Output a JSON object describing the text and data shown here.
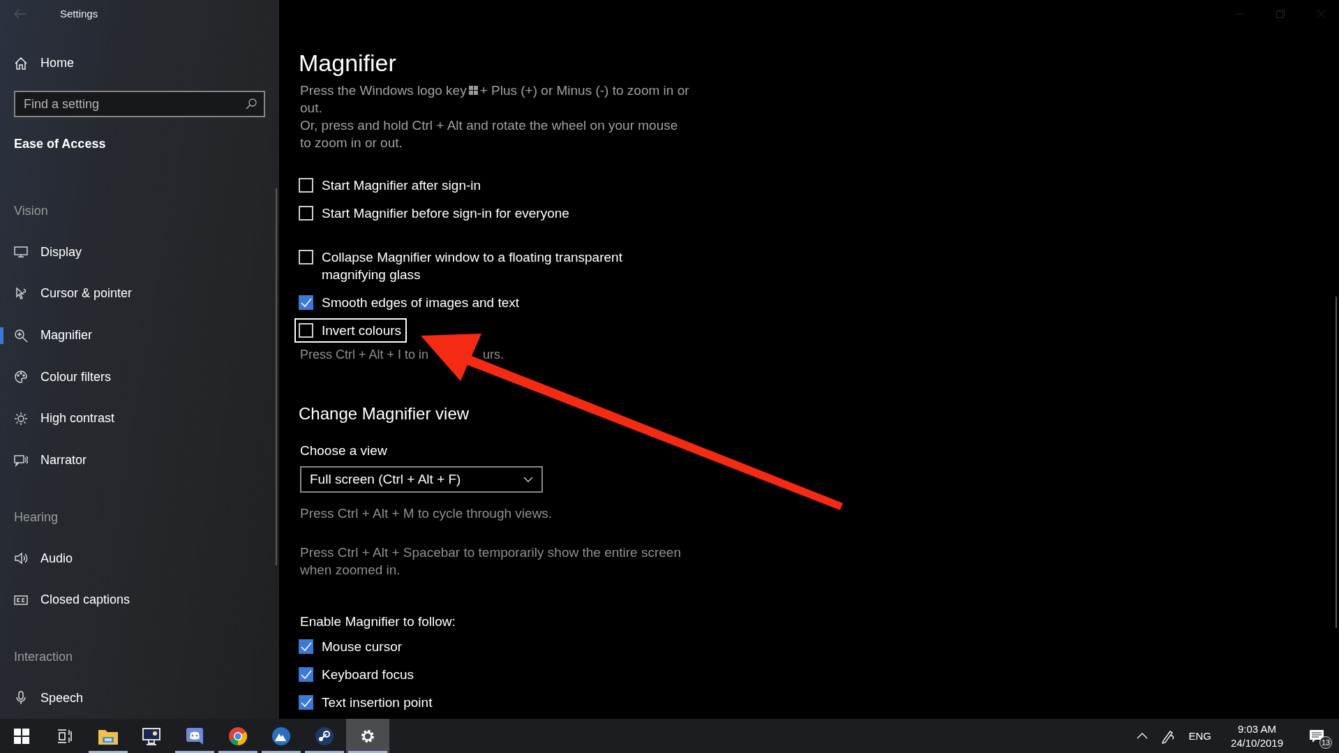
{
  "window": {
    "title": "Settings"
  },
  "sidebar": {
    "home": "Home",
    "search": {
      "placeholder": "Find a setting"
    },
    "heading": "Ease of Access",
    "groups": [
      {
        "label": "Vision",
        "items": [
          {
            "label": "Display",
            "kind": "display",
            "selected": false
          },
          {
            "label": "Cursor & pointer",
            "kind": "cursor",
            "selected": false
          },
          {
            "label": "Magnifier",
            "kind": "magnifier",
            "selected": true
          },
          {
            "label": "Colour filters",
            "kind": "palette",
            "selected": false
          },
          {
            "label": "High contrast",
            "kind": "sun",
            "selected": false
          },
          {
            "label": "Narrator",
            "kind": "narrator",
            "selected": false
          }
        ]
      },
      {
        "label": "Hearing",
        "items": [
          {
            "label": "Audio",
            "kind": "speaker",
            "selected": false
          },
          {
            "label": "Closed captions",
            "kind": "captions",
            "selected": false
          }
        ]
      },
      {
        "label": "Interaction",
        "items": [
          {
            "label": "Speech",
            "kind": "mic",
            "selected": false
          }
        ]
      }
    ]
  },
  "page": {
    "title": "Magnifier",
    "intro": {
      "before_key": "Press the Windows logo key",
      "after_key": "+ Plus (+) or Minus (-) to zoom in or",
      "continued": "out."
    },
    "intro_2": "Or, press and hold Ctrl + Alt and rotate the wheel on your mouse to zoom in or out.",
    "option_groups": [
      [
        {
          "label": "Start Magnifier after sign-in",
          "checked": false,
          "focused": false
        },
        {
          "label": "Start Magnifier before sign-in for everyone",
          "checked": false,
          "focused": false
        }
      ],
      [
        {
          "label": "Collapse Magnifier window to a floating transparent magnifying glass",
          "checked": false,
          "focused": false
        },
        {
          "label": "Smooth edges of images and text",
          "checked": true,
          "focused": false
        },
        {
          "label": "Invert colours",
          "checked": false,
          "focused": true
        }
      ]
    ],
    "invert_hint": {
      "start": "Press Ctrl + Alt + I to in",
      "end": "urs."
    },
    "view_section": {
      "heading": "Change Magnifier view",
      "label": "Choose a view",
      "dropdown": "Full screen (Ctrl + Alt + F)",
      "hints": [
        "Press Ctrl + Alt + M to cycle through views.",
        "Press Ctrl + Alt + Spacebar to temporarily show the entire screen when zoomed in."
      ]
    },
    "follow": {
      "label": "Enable Magnifier to follow:",
      "options": [
        {
          "label": "Mouse cursor",
          "checked": true,
          "focused": false
        },
        {
          "label": "Keyboard focus",
          "checked": true,
          "focused": false
        },
        {
          "label": "Text insertion point",
          "checked": true,
          "focused": false
        }
      ]
    }
  },
  "taskbar": {
    "apps": [
      {
        "kind": "start",
        "running": false,
        "active": false
      },
      {
        "kind": "taskview",
        "running": false,
        "active": false
      },
      {
        "kind": "folder",
        "running": true,
        "active": false
      },
      {
        "kind": "monitor",
        "running": false,
        "active": false
      },
      {
        "kind": "chat",
        "running": true,
        "active": false
      },
      {
        "kind": "browser",
        "running": true,
        "active": false
      },
      {
        "kind": "mountain",
        "running": true,
        "active": false
      },
      {
        "kind": "steam",
        "running": true,
        "active": false
      },
      {
        "kind": "gear",
        "running": true,
        "active": true
      }
    ],
    "tray": {
      "language": "ENG",
      "time": "9:03 AM",
      "date": "24/10/2019",
      "notifications": "13"
    }
  }
}
